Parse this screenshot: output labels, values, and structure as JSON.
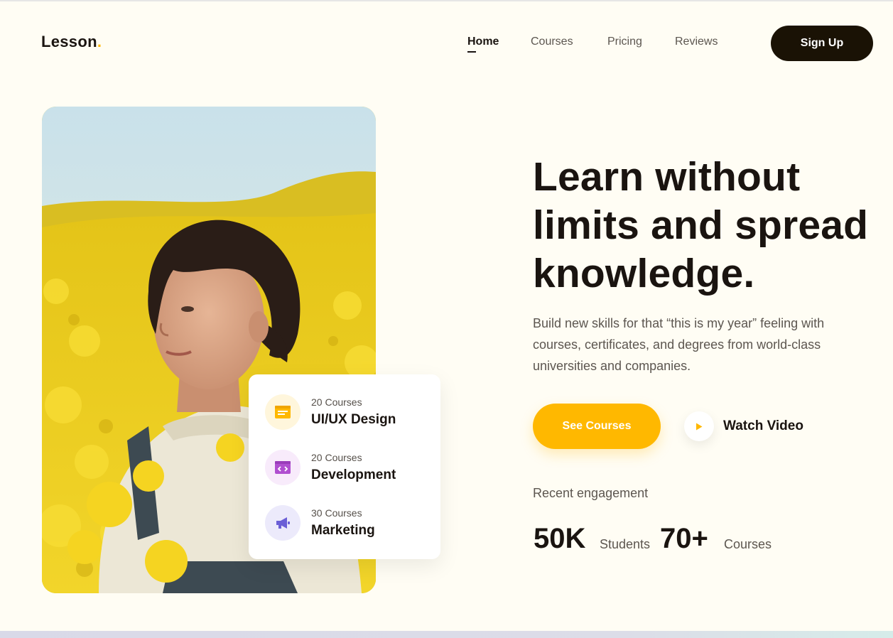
{
  "brand": {
    "name": "Lesson",
    "dot": ".",
    "accent": "#ffb800",
    "dark": "#1a1205",
    "background": "#fffdf4"
  },
  "nav": {
    "items": [
      {
        "label": "Home",
        "active": true
      },
      {
        "label": "Courses",
        "active": false
      },
      {
        "label": "Pricing",
        "active": false
      },
      {
        "label": "Reviews",
        "active": false
      }
    ],
    "signup_label": "Sign Up"
  },
  "hero": {
    "headline": "Learn without limits and spread knowledge.",
    "subtext": "Build new skills for that “this is my year” feeling with courses, certificates, and degrees from world-class universities and companies.",
    "primary_cta": "See Courses",
    "video_cta": "Watch Video",
    "engagement_label": "Recent engagement",
    "stats": [
      {
        "value": "50K",
        "label": "Students"
      },
      {
        "value": "70+",
        "label": "Courses"
      }
    ]
  },
  "course_card": {
    "items": [
      {
        "count": "20 Courses",
        "title": "UI/UX Design",
        "icon": "layout-icon",
        "icon_color": "#ffb800",
        "icon_bg": "#fff6dc"
      },
      {
        "count": "20 Courses",
        "title": "Development",
        "icon": "code-window-icon",
        "icon_color": "#b04fd0",
        "icon_bg": "#f8ebfb"
      },
      {
        "count": "30 Courses",
        "title": "Marketing",
        "icon": "megaphone-icon",
        "icon_color": "#6b5fd6",
        "icon_bg": "#eceafb"
      }
    ]
  }
}
